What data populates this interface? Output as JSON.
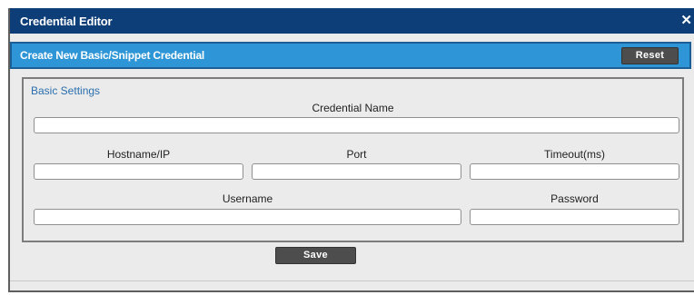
{
  "dialog": {
    "title": "Credential Editor",
    "close_symbol": "✕"
  },
  "panel": {
    "title": "Create New Basic/Snippet Credential",
    "reset_label": "Reset"
  },
  "basic_settings": {
    "legend": "Basic Settings",
    "credential_name": {
      "label": "Credential Name",
      "value": ""
    },
    "hostname": {
      "label": "Hostname/IP",
      "value": ""
    },
    "port": {
      "label": "Port",
      "value": ""
    },
    "timeout": {
      "label": "Timeout(ms)",
      "value": ""
    },
    "username": {
      "label": "Username",
      "value": ""
    },
    "password": {
      "label": "Password",
      "value": ""
    }
  },
  "actions": {
    "save_label": "Save"
  },
  "colors": {
    "titlebar": "#0d3e78",
    "panel_header": "#2e96d6",
    "button": "#4d4d4d",
    "legend_text": "#2a6fae"
  }
}
